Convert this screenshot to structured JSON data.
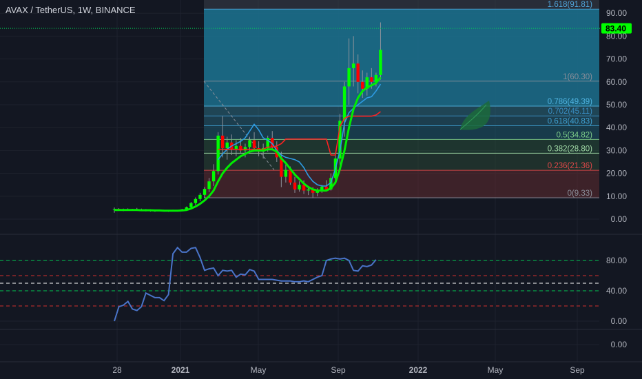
{
  "header": {
    "title": "AVAX / TetherUS, 1W, BINANCE"
  },
  "colors": {
    "background": "#131722",
    "grid": "#1e222d",
    "up": "#00ff00",
    "down": "#ff0000",
    "blue_line": "#2e9be3",
    "red_line": "#ff2222",
    "green_line": "#00ee00",
    "oscillator": "#4a74c9",
    "price_tag": "#00ff00"
  },
  "chart_data": [
    {
      "type": "candlestick",
      "name": "price",
      "y_axis": {
        "ticks": [
          "90.00",
          "80.00",
          "70.00",
          "60.00",
          "50.00",
          "40.00",
          "30.00",
          "20.00",
          "10.00",
          "0.00"
        ],
        "ylim": [
          -5,
          96
        ]
      },
      "x_axis": {
        "ticks": [
          "28",
          "2021",
          "May",
          "Sep",
          "2022",
          "May",
          "Sep"
        ]
      },
      "last_price": "83.40",
      "fib_levels": [
        {
          "label": "1.618(91.81)",
          "value": 91.81,
          "color": "#4fa3d9"
        },
        {
          "label": "1(60.30)",
          "value": 60.3,
          "color": "#8a8e99"
        },
        {
          "label": "0.786(49.39)",
          "value": 49.39,
          "color": "#4fb3e0"
        },
        {
          "label": "0.702(45.11)",
          "value": 45.11,
          "color": "#3a8fc6"
        },
        {
          "label": "0.618(40.83)",
          "value": 40.83,
          "color": "#3fa0d2"
        },
        {
          "label": "0.5(34.82)",
          "value": 34.82,
          "color": "#7fcf8a"
        },
        {
          "label": "0.382(28.80)",
          "value": 28.8,
          "color": "#a0d8a5"
        },
        {
          "label": "0.236(21.36)",
          "value": 21.36,
          "color": "#e04848"
        },
        {
          "label": "0(9.33)",
          "value": 9.33,
          "color": "#8a8e99"
        }
      ],
      "candles": [
        [
          4.2,
          5.1,
          2.8,
          4.5
        ],
        [
          4.5,
          4.8,
          3.6,
          4.0
        ],
        [
          4.0,
          4.6,
          3.5,
          4.3
        ],
        [
          4.3,
          4.7,
          3.9,
          4.1
        ],
        [
          4.1,
          4.5,
          3.8,
          4.4
        ],
        [
          4.4,
          4.9,
          4.0,
          4.2
        ],
        [
          4.2,
          4.6,
          3.7,
          3.9
        ],
        [
          3.9,
          4.4,
          3.4,
          4.0
        ],
        [
          4.0,
          4.3,
          3.3,
          3.6
        ],
        [
          3.6,
          4.0,
          3.2,
          3.8
        ],
        [
          3.8,
          4.2,
          3.5,
          3.7
        ],
        [
          3.7,
          4.1,
          3.3,
          3.5
        ],
        [
          3.5,
          4.0,
          3.2,
          3.8
        ],
        [
          3.8,
          4.1,
          3.4,
          3.6
        ],
        [
          3.6,
          4.0,
          3.3,
          3.9
        ],
        [
          3.9,
          4.5,
          3.5,
          4.3
        ],
        [
          4.3,
          5.5,
          3.9,
          5.2
        ],
        [
          5.2,
          7.5,
          4.8,
          7.0
        ],
        [
          7.0,
          9.5,
          6.2,
          8.8
        ],
        [
          8.8,
          11.5,
          7.8,
          10.6
        ],
        [
          10.6,
          14.0,
          9.2,
          13.2
        ],
        [
          13.2,
          18.0,
          11.8,
          16.5
        ],
        [
          16.5,
          24.0,
          14.5,
          21.0
        ],
        [
          21.0,
          38.0,
          19.5,
          36.5
        ],
        [
          36.5,
          45.0,
          27.0,
          31.0
        ],
        [
          31.0,
          36.0,
          26.0,
          33.5
        ],
        [
          33.5,
          37.0,
          28.0,
          30.5
        ],
        [
          30.5,
          34.5,
          27.5,
          32.0
        ],
        [
          32.0,
          35.5,
          29.0,
          30.0
        ],
        [
          30.0,
          33.0,
          27.0,
          31.5
        ],
        [
          31.5,
          36.0,
          29.5,
          34.5
        ],
        [
          34.5,
          38.0,
          30.5,
          31.0
        ],
        [
          31.0,
          34.0,
          27.5,
          29.5
        ],
        [
          29.5,
          33.0,
          26.5,
          31.0
        ],
        [
          31.0,
          36.5,
          29.5,
          35.5
        ],
        [
          35.5,
          38.5,
          30.0,
          31.5
        ],
        [
          31.5,
          34.0,
          25.0,
          27.0
        ],
        [
          27.0,
          29.5,
          14.0,
          18.5
        ],
        [
          18.5,
          24.0,
          16.0,
          21.5
        ],
        [
          21.5,
          23.0,
          15.0,
          16.0
        ],
        [
          16.0,
          18.5,
          11.5,
          13.0
        ],
        [
          13.0,
          16.5,
          12.0,
          15.0
        ],
        [
          15.0,
          17.0,
          11.0,
          12.5
        ],
        [
          12.5,
          14.0,
          10.5,
          13.0
        ],
        [
          13.0,
          14.0,
          9.4,
          11.5
        ],
        [
          11.5,
          13.5,
          10.0,
          12.8
        ],
        [
          12.8,
          15.0,
          11.5,
          14.2
        ],
        [
          14.2,
          17.0,
          12.5,
          13.0
        ],
        [
          13.0,
          20.0,
          12.5,
          18.0
        ],
        [
          18.0,
          28.0,
          15.5,
          26.5
        ],
        [
          26.5,
          46.0,
          22.0,
          43.0
        ],
        [
          43.0,
          60.0,
          36.0,
          58.0
        ],
        [
          58.0,
          79.0,
          50.0,
          66.0
        ],
        [
          66.0,
          80.0,
          58.0,
          68.0
        ],
        [
          68.0,
          72.0,
          55.0,
          60.0
        ],
        [
          60.0,
          65.0,
          53.0,
          57.0
        ],
        [
          57.0,
          64.0,
          54.0,
          62.0
        ],
        [
          62.0,
          66.0,
          57.0,
          60.0
        ],
        [
          60.0,
          64.0,
          58.0,
          63.0
        ],
        [
          63.0,
          86.0,
          61.0,
          74.0
        ]
      ],
      "lines": {
        "green_line": [
          4.0,
          4.0,
          4.0,
          4.0,
          4.0,
          4.0,
          3.9,
          3.9,
          3.9,
          3.8,
          3.8,
          3.7,
          3.7,
          3.7,
          3.7,
          3.8,
          4.0,
          4.6,
          5.5,
          6.7,
          8.2,
          10.0,
          12.5,
          16.5,
          20.0,
          22.5,
          24.5,
          26.0,
          27.5,
          28.5,
          29.5,
          30.0,
          30.0,
          30.0,
          30.5,
          30.5,
          29.5,
          26.5,
          24.5,
          22.0,
          19.5,
          17.5,
          15.5,
          14.0,
          13.0,
          12.5,
          12.5,
          12.5,
          13.5,
          16.0,
          22.0,
          30.0,
          40.0,
          48.0,
          53.0,
          56.0,
          57.5,
          58.5,
          59.5,
          62.0
        ],
        "blue_line": [
          null,
          null,
          null,
          null,
          null,
          null,
          null,
          null,
          null,
          null,
          null,
          null,
          null,
          null,
          null,
          null,
          null,
          null,
          null,
          null,
          null,
          null,
          null,
          26.0,
          28.5,
          30.5,
          32.0,
          33.0,
          34.0,
          35.5,
          38.5,
          41.5,
          39.0,
          35.5,
          34.5,
          33.0,
          30.0,
          28.0,
          27.0,
          26.5,
          26.0,
          25.0,
          22.5,
          19.0,
          16.5,
          15.0,
          14.5,
          14.5,
          16.0,
          22.0,
          30.0,
          42.0,
          46.5,
          48.5,
          50.0,
          51.5,
          53.0,
          53.5,
          56.0,
          59.0
        ],
        "red_line": [
          null,
          null,
          null,
          null,
          null,
          null,
          null,
          null,
          null,
          null,
          null,
          null,
          null,
          null,
          null,
          null,
          null,
          null,
          null,
          null,
          null,
          null,
          null,
          30.5,
          30.5,
          30.5,
          30.5,
          30.5,
          30.5,
          30.5,
          30.5,
          30.5,
          30.5,
          30.5,
          31.5,
          31.5,
          32.0,
          33.0,
          35.0,
          35.0,
          35.0,
          35.0,
          35.0,
          35.0,
          35.0,
          35.0,
          35.0,
          35.0,
          28.0,
          28.0,
          40.5,
          44.0,
          45.0,
          45.0,
          45.0,
          45.0,
          45.0,
          45.0,
          45.5,
          47.0
        ]
      }
    },
    {
      "type": "line",
      "name": "oscillator",
      "y_axis": {
        "ticks": [
          "80.00",
          "40.00",
          "0.00",
          "0.00"
        ]
      },
      "levels": [
        {
          "value": 80,
          "color": "#00c853"
        },
        {
          "value": 60,
          "color": "#d32f2f"
        },
        {
          "value": 50,
          "color": "#ffffff"
        },
        {
          "value": 40,
          "color": "#00c853"
        },
        {
          "value": 20,
          "color": "#d32f2f"
        }
      ],
      "values": [
        0,
        19,
        21,
        26,
        16,
        14,
        19,
        37,
        34,
        31,
        31,
        27,
        35,
        89,
        97,
        91,
        91,
        96,
        97,
        84,
        67,
        69,
        70,
        60,
        67,
        66,
        67,
        58,
        62,
        61,
        68,
        66,
        55,
        55,
        55,
        55,
        54,
        53,
        53,
        53,
        52,
        52,
        53,
        52,
        55,
        58,
        60,
        80,
        82,
        83,
        82,
        83,
        80,
        67,
        66,
        73,
        72,
        74,
        81,
        null
      ]
    }
  ]
}
